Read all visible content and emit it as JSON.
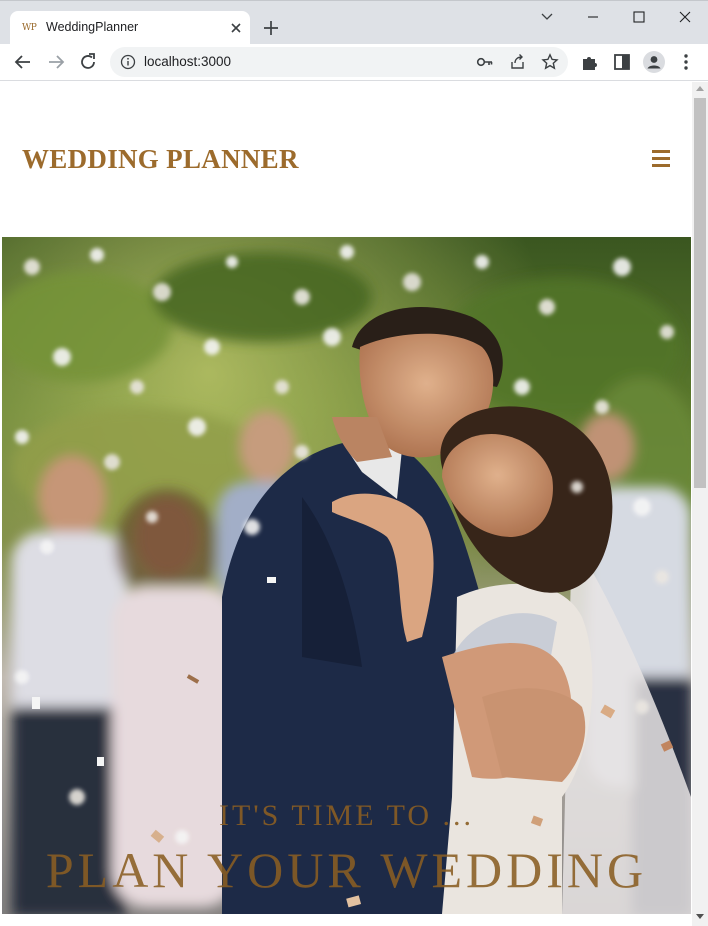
{
  "browser": {
    "tab": {
      "title": "WeddingPlanner",
      "favicon_text": "WP"
    },
    "url": "localhost:3000",
    "icons": [
      "chevron-down-icon",
      "minimize-icon",
      "maximize-icon",
      "close-icon",
      "back-icon",
      "forward-icon",
      "reload-icon",
      "info-icon",
      "key-icon",
      "share-icon",
      "star-icon",
      "extensions-icon",
      "side-panel-icon",
      "profile-icon",
      "more-icon"
    ]
  },
  "site": {
    "logo": "WEDDING PLANNER",
    "hero": {
      "kicker": "IT'S TIME TO ...",
      "headline": "PLAN YOUR WEDDING",
      "image": "wedding-couple-photo"
    }
  },
  "colors": {
    "brand": "#9c6b2c",
    "hero_text": "#8a5e23"
  }
}
